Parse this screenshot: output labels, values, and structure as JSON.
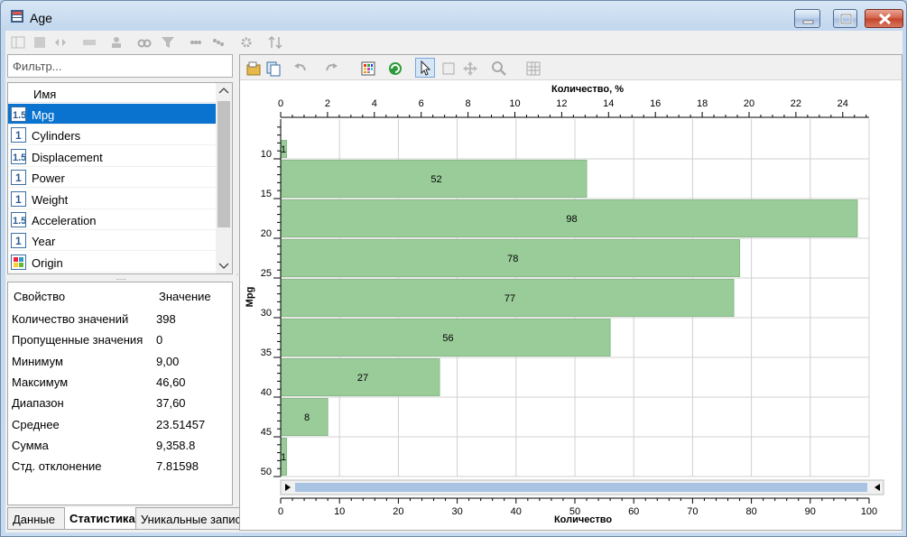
{
  "window": {
    "title": "Age",
    "min_label": "",
    "max_label": "",
    "close_label": ""
  },
  "filter": {
    "placeholder": "Фильтр..."
  },
  "variables": {
    "header": "Имя",
    "items": [
      {
        "label": "Mpg",
        "icon": "decimal-icon",
        "selected": true
      },
      {
        "label": "Cylinders",
        "icon": "integer-icon"
      },
      {
        "label": "Displacement",
        "icon": "decimal-icon"
      },
      {
        "label": "Power",
        "icon": "integer-icon"
      },
      {
        "label": "Weight",
        "icon": "integer-icon"
      },
      {
        "label": "Acceleration",
        "icon": "decimal-icon"
      },
      {
        "label": "Year",
        "icon": "integer-icon"
      },
      {
        "label": "Origin",
        "icon": "category-icon"
      }
    ]
  },
  "stats": {
    "header_property": "Свойство",
    "header_value": "Значение",
    "rows": [
      {
        "k": "Количество значений",
        "v": "398"
      },
      {
        "k": "Пропущенные значения",
        "v": "0"
      },
      {
        "k": "Минимум",
        "v": "9,00"
      },
      {
        "k": "Максимум",
        "v": "46,60"
      },
      {
        "k": "Диапазон",
        "v": "37,60"
      },
      {
        "k": "Среднее",
        "v": "23.51457"
      },
      {
        "k": "Сумма",
        "v": "9,358.8"
      },
      {
        "k": "Стд. отклонение",
        "v": "7.81598"
      }
    ]
  },
  "tabs": [
    {
      "label": "Данные",
      "active": false
    },
    {
      "label": "Статистика",
      "active": true
    },
    {
      "label": "Уникальные записи",
      "active": false
    }
  ],
  "colors": {
    "bar": "#99cc99",
    "bar_stroke": "#88bb88",
    "selection": "#0a73d0",
    "scroll_track": "#a9c3e3"
  },
  "chart_data": {
    "type": "bar",
    "orientation": "horizontal",
    "title": "",
    "top_axis_label": "Количество, %",
    "bottom_axis_label": "Количество",
    "y_axis_label": "Mpg",
    "bins": [
      {
        "from": 7.5,
        "to": 10,
        "count": 1
      },
      {
        "from": 10,
        "to": 15,
        "count": 52
      },
      {
        "from": 15,
        "to": 20,
        "count": 98
      },
      {
        "from": 20,
        "to": 25,
        "count": 78
      },
      {
        "from": 25,
        "to": 30,
        "count": 77
      },
      {
        "from": 30,
        "to": 35,
        "count": 56
      },
      {
        "from": 35,
        "to": 40,
        "count": 27
      },
      {
        "from": 40,
        "to": 45,
        "count": 8
      },
      {
        "from": 45,
        "to": 50,
        "count": 1
      }
    ],
    "bottom_ticks": [
      0,
      10,
      20,
      30,
      40,
      50,
      60,
      70,
      80,
      90,
      100
    ],
    "top_ticks": [
      0,
      2,
      4,
      6,
      8,
      10,
      12,
      14,
      16,
      18,
      20,
      22,
      24
    ],
    "y_ticks": [
      10,
      15,
      20,
      25,
      30,
      35,
      40,
      45,
      50
    ],
    "xlim": [
      0,
      100
    ],
    "ylim": [
      5,
      50
    ],
    "total": 398,
    "grid": true
  }
}
